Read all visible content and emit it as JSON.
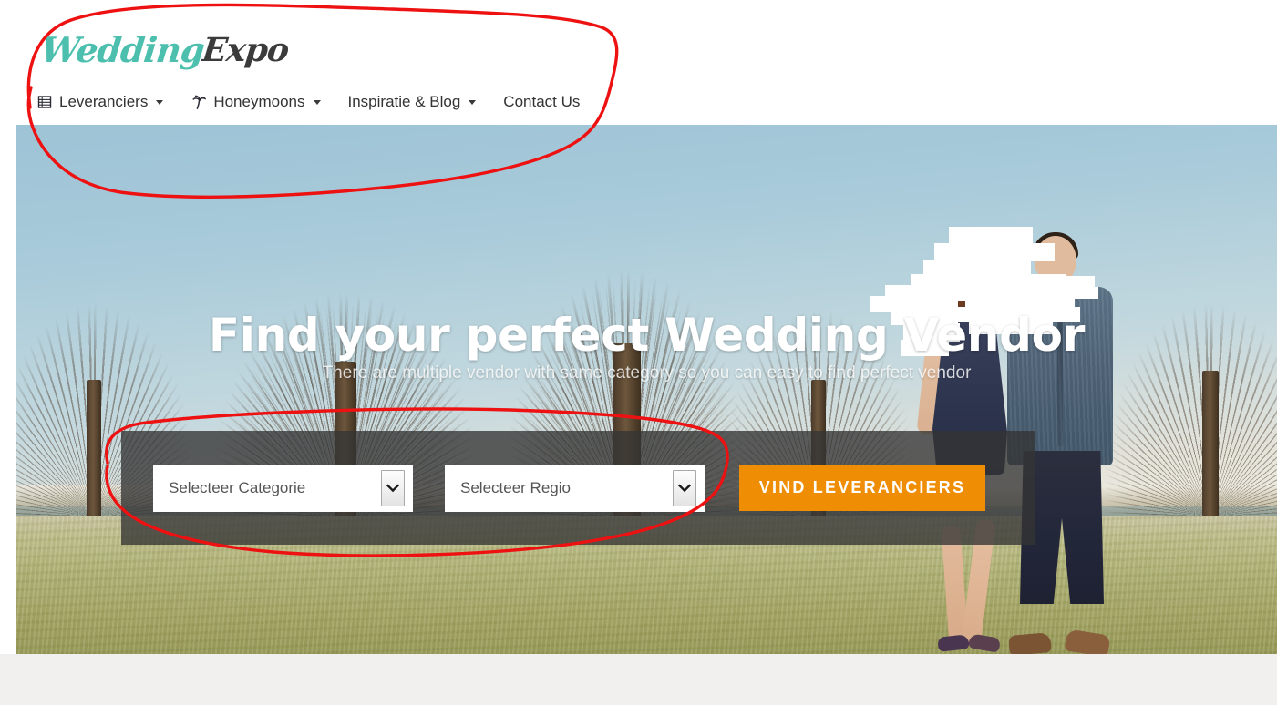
{
  "header": {
    "brand": {
      "part1": "Wedding",
      "part2": "Expo",
      "color1": "#4cbfae",
      "color2": "#3b3b3b"
    },
    "nav": [
      {
        "label": "Leveranciers",
        "icon": "list-table-icon",
        "has_caret": true
      },
      {
        "label": "Honeymoons",
        "icon": "palm-tree-icon",
        "has_caret": true
      },
      {
        "label": "Inspiratie & Blog",
        "icon": "none",
        "has_caret": true
      },
      {
        "label": "Contact Us",
        "icon": "none",
        "has_caret": false
      }
    ]
  },
  "hero": {
    "title": "Find your perfect Wedding Vendor",
    "subtitle": "There are multiple vendor with same category so you can easy to find perfect vendor",
    "image_description": "Couple walking on a grass field with bare trees under a blue sky",
    "redaction_note": "white brush scribble covering the couple's faces"
  },
  "search": {
    "category_select": {
      "value": "Selecteer Categorie",
      "icon": "chevron-down-icon"
    },
    "region_select": {
      "value": "Selecteer Regio",
      "icon": "chevron-down-icon"
    },
    "submit_label": "VIND LEVERANCIERS",
    "submit_color": "#ef8e05",
    "panel_color": "rgba(52,52,52,0.78)"
  },
  "annotations": {
    "color": "#ee1111",
    "shapes": [
      {
        "name": "header-circle",
        "note": "hand-drawn red ellipse around the logo and navigation bar"
      },
      {
        "name": "selects-circle",
        "note": "hand-drawn red ellipse around both dropdown selects"
      }
    ]
  },
  "below": {
    "background": "#f1f0ee"
  }
}
